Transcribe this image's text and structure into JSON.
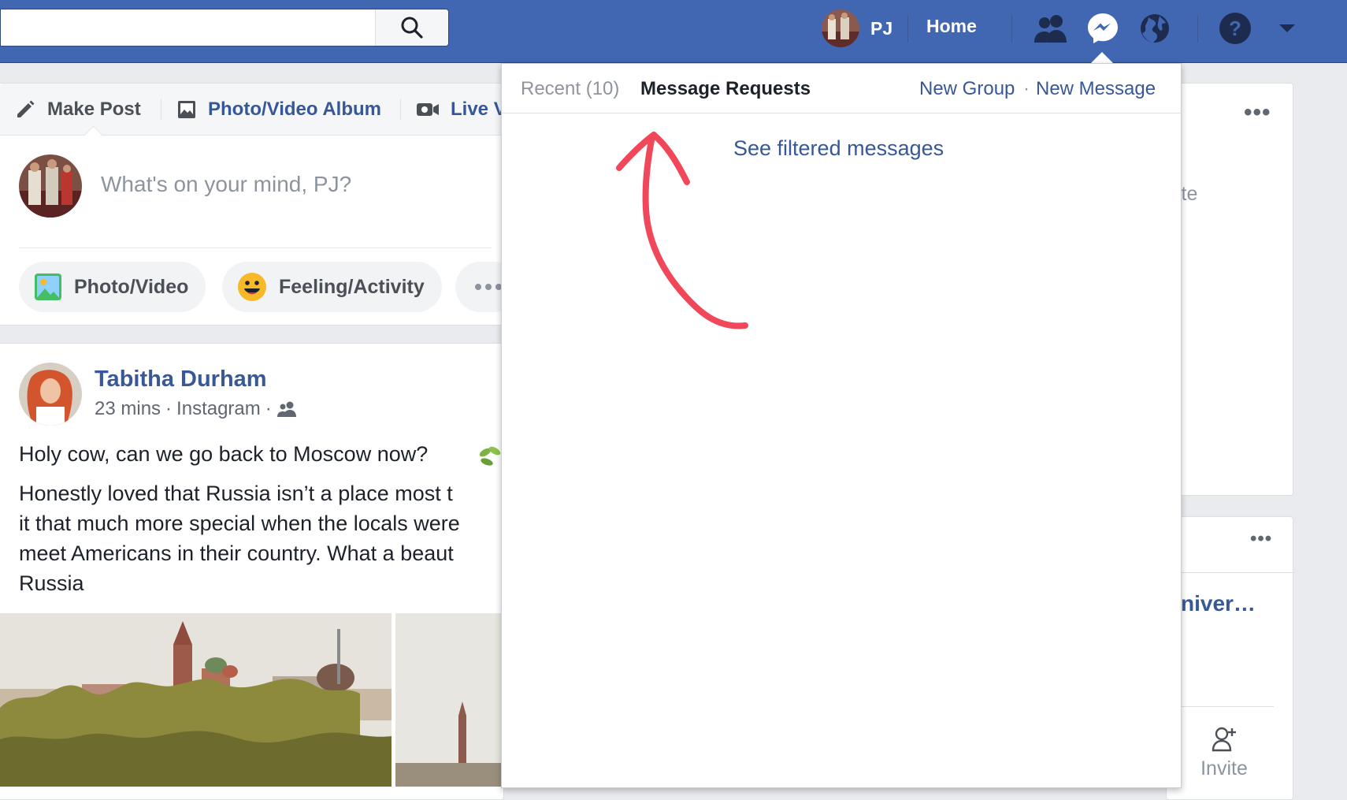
{
  "topbar": {
    "search_placeholder": "",
    "profile_name": "PJ",
    "home_label": "Home"
  },
  "composer": {
    "tabs": [
      "Make Post",
      "Photo/Video Album",
      "Live V"
    ],
    "prompt": "What's on your mind, PJ?",
    "actions": [
      "Photo/Video",
      "Feeling/Activity"
    ]
  },
  "post": {
    "author": "Tabitha Durham",
    "time": "23 mins",
    "source": "Instagram",
    "meta_sep": "·",
    "text_lines": [
      "Holy cow, can we go back to Moscow now?",
      "Honestly loved that Russia isn’t a place most t",
      "it that much more special when the locals were",
      "meet Americans in their country. What a beaut",
      "Russia"
    ]
  },
  "right_column": {
    "card1_text": "ite",
    "card2_text": "niver…",
    "invite_label": "Invite"
  },
  "messages_dropdown": {
    "recent_label": "Recent (10)",
    "requests_label": "Message Requests",
    "new_group": "New Group",
    "separator": "·",
    "new_message": "New Message",
    "filtered_link": "See filtered messages"
  },
  "colors": {
    "brand_blue": "#4267b2",
    "link_blue": "#365899",
    "annotation_red": "#f0475b"
  }
}
